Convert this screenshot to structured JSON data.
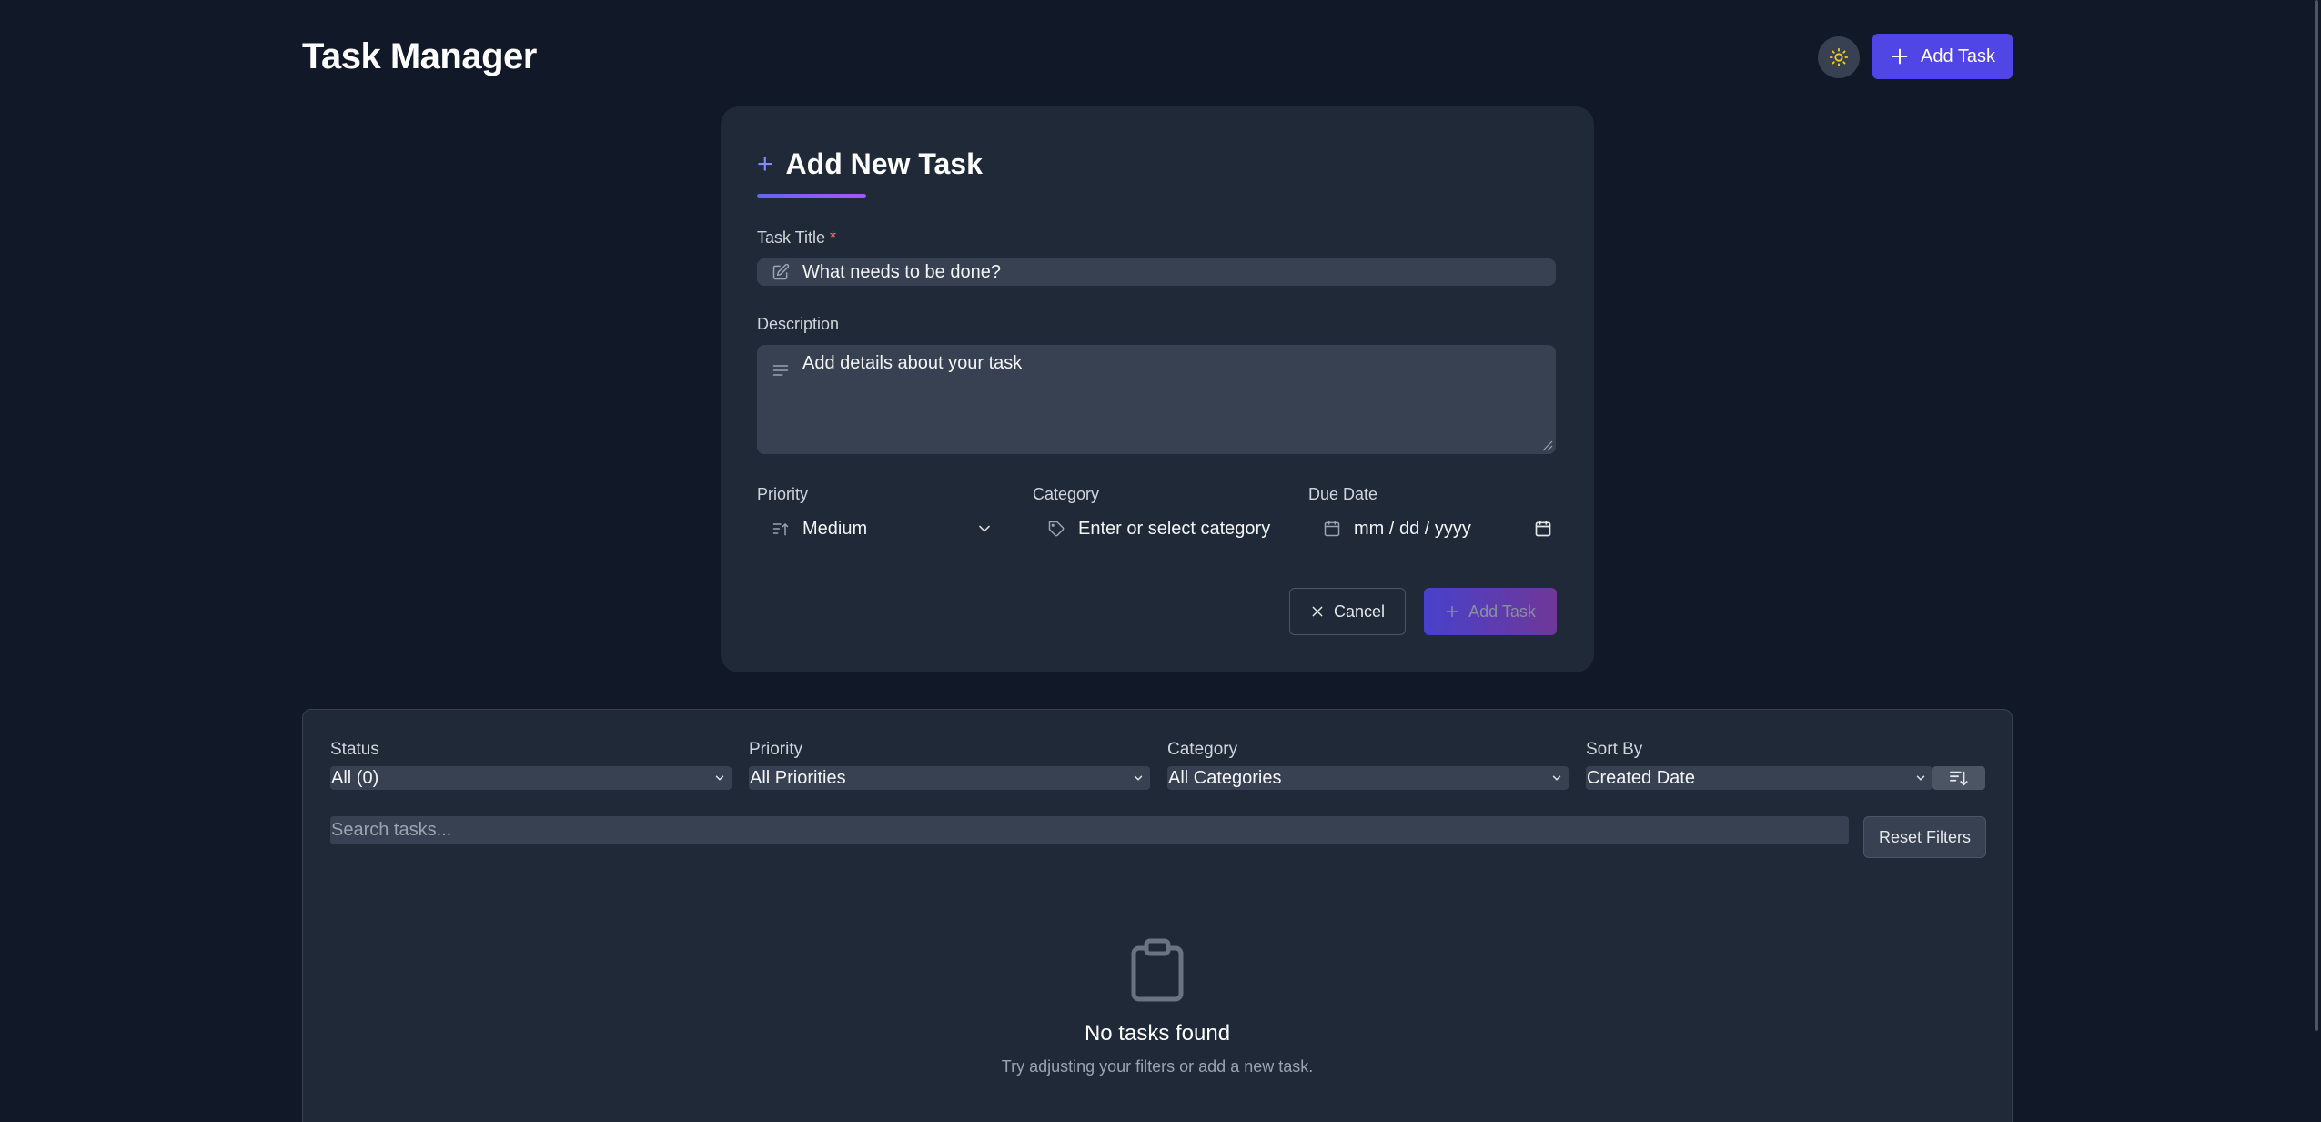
{
  "header": {
    "title": "Task Manager",
    "add_button_label": "Add Task"
  },
  "form": {
    "heading": "Add New Task",
    "title_label": "Task Title",
    "title_required_mark": "*",
    "title_placeholder": "What needs to be done?",
    "description_label": "Description",
    "description_placeholder": "Add details about your task",
    "priority_label": "Priority",
    "priority_value": "Medium",
    "category_label": "Category",
    "category_placeholder": "Enter or select category",
    "due_date_label": "Due Date",
    "due_date_placeholder": "mm / dd / yyyy",
    "cancel_label": "Cancel",
    "submit_label": "Add Task"
  },
  "filters": {
    "status_label": "Status",
    "status_value": "All (0)",
    "priority_label": "Priority",
    "priority_value": "All Priorities",
    "category_label": "Category",
    "category_value": "All Categories",
    "sort_label": "Sort By",
    "sort_value": "Created Date",
    "search_placeholder": "Search tasks...",
    "reset_label": "Reset Filters"
  },
  "empty_state": {
    "title": "No tasks found",
    "subtitle": "Try adjusting your filters or add a new task."
  },
  "colors": {
    "background": "#111827",
    "card": "#1f2937",
    "input": "#374151",
    "accent": "#4f46e5",
    "accent_purple": "#a855f7",
    "sun": "#facc15"
  }
}
